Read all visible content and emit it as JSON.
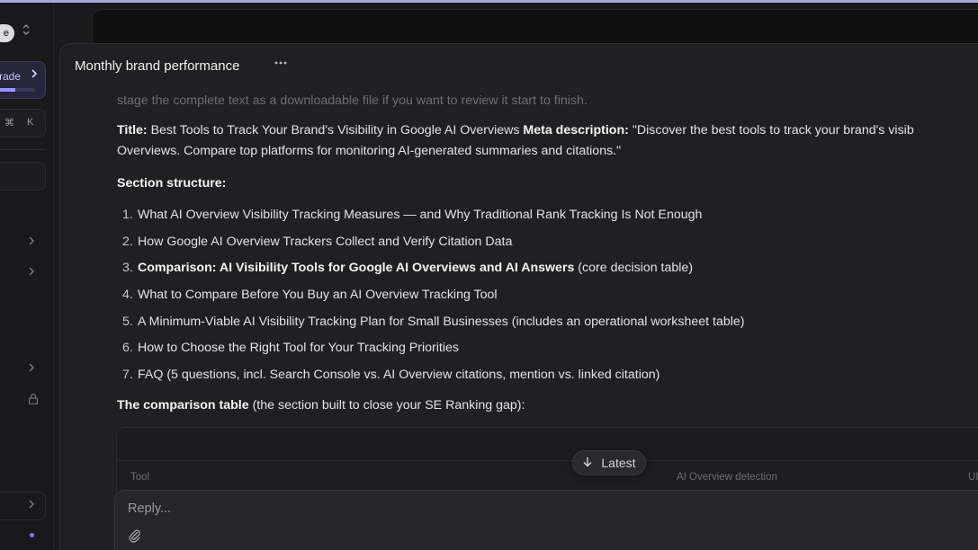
{
  "sidebar": {
    "workspace_badge": "e",
    "workspace_switch_icon": "chevron-up-down-icon",
    "upgrade": {
      "label": "rade",
      "progress": 0.45,
      "chevron_icon": "chevron-right-icon"
    },
    "shortcut": {
      "key1": "⌘",
      "key2": "K"
    },
    "nav_chevron_icon": "chevron-right-icon",
    "lock_icon": "lock-icon",
    "accent_color": "#7f78ff"
  },
  "chat": {
    "title": "Monthly brand performance",
    "more_icon": "ellipsis-icon",
    "faded_intro": "stage the complete text as a downloadable file if you want to review it start to finish.",
    "title_label": "Title:",
    "title_text": " Best Tools to Track Your Brand's Visibility in Google AI Overviews ",
    "meta_label": "Meta description:",
    "meta_text_1": " \"Discover the best tools to track your brand's visib",
    "meta_text_2": "Overviews. Compare top platforms for monitoring AI-generated summaries and citations.\"",
    "section_heading": "Section structure:",
    "outline": [
      {
        "num": "1.",
        "text": "What AI Overview Visibility Tracking Measures — and Why Traditional Rank Tracking Is Not Enough"
      },
      {
        "num": "2.",
        "text": "How Google AI Overview Trackers Collect and Verify Citation Data"
      },
      {
        "num": "3.",
        "bold": "Comparison: AI Visibility Tools for Google AI Overviews and AI Answers",
        "text": " (core decision table)"
      },
      {
        "num": "4.",
        "text": "What to Compare Before You Buy an AI Overview Tracking Tool"
      },
      {
        "num": "5.",
        "text": "A Minimum-Viable AI Visibility Tracking Plan for Small Businesses (includes an operational worksheet table)"
      },
      {
        "num": "6.",
        "text": "How to Choose the Right Tool for Your Tracking Priorities"
      },
      {
        "num": "7.",
        "text": "FAQ (5 questions, incl. Search Console vs. AI Overview citations, mention vs. linked citation)"
      }
    ],
    "comparison_bold": "The comparison table",
    "comparison_text": " (the section built to close your SE Ranking gap):",
    "table_headers": [
      "Tool",
      "AI Overview detection",
      "UI"
    ],
    "latest_label": "Latest",
    "latest_icon": "arrow-down-icon",
    "reply_placeholder": "Reply...",
    "attach_icon": "paperclip-icon"
  }
}
